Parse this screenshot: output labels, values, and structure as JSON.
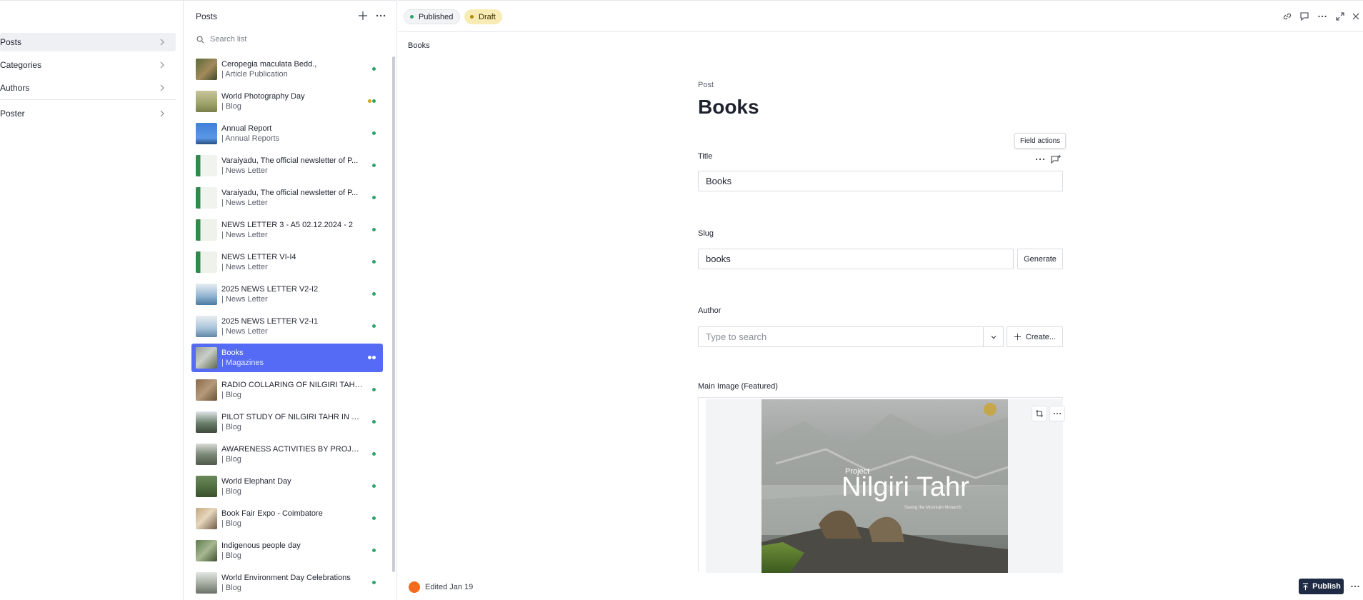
{
  "nav": {
    "items": [
      {
        "label": "Posts"
      },
      {
        "label": "Categories"
      },
      {
        "label": "Authors"
      },
      {
        "label": "Poster"
      }
    ]
  },
  "list": {
    "title": "Posts",
    "search_placeholder": "Search list",
    "rows": [
      {
        "title": "Ceropegia maculata Bedd.,",
        "sub": "| Article Publication"
      },
      {
        "title": "World Photography Day",
        "sub": "| Blog"
      },
      {
        "title": "Annual Report",
        "sub": "| Annual Reports"
      },
      {
        "title": "Varaiyadu, The official newsletter of P...",
        "sub": "| News Letter"
      },
      {
        "title": "Varaiyadu, The official newsletter of P...",
        "sub": "| News Letter"
      },
      {
        "title": "NEWS LETTER 3 - A5 02.12.2024 - 2",
        "sub": "| News Letter"
      },
      {
        "title": "NEWS LETTER VI-I4",
        "sub": "| News Letter"
      },
      {
        "title": "2025 NEWS LETTER V2-I2",
        "sub": "| News Letter"
      },
      {
        "title": "2025 NEWS LETTER V2-I1",
        "sub": "| News Letter"
      },
      {
        "title": "Books",
        "sub": "| Magazines"
      },
      {
        "title": "RADIO COLLARING OF NILGIRI TAHR ...",
        "sub": "| Blog"
      },
      {
        "title": "PILOT STUDY OF NILGIRI TAHR IN GR...",
        "sub": "| Blog"
      },
      {
        "title": "AWARENESS ACTIVITIES BY PROJECT ...",
        "sub": "| Blog"
      },
      {
        "title": "World Elephant Day",
        "sub": "| Blog"
      },
      {
        "title": "Book Fair Expo - Coimbatore",
        "sub": "| Blog"
      },
      {
        "title": "Indigenous people day",
        "sub": "| Blog"
      },
      {
        "title": "World Environment Day Celebrations",
        "sub": "| Blog"
      }
    ]
  },
  "header": {
    "published_label": "Published",
    "draft_label": "Draft"
  },
  "breadcrumb": "Books",
  "document": {
    "type_label": "Post",
    "title": "Books",
    "field_actions_tooltip": "Field actions"
  },
  "fields": {
    "title": {
      "label": "Title",
      "value": "Books"
    },
    "slug": {
      "label": "Slug",
      "value": "books",
      "generate_label": "Generate"
    },
    "author": {
      "label": "Author",
      "placeholder": "Type to search",
      "create_label": "Create..."
    },
    "main_image": {
      "label": "Main Image (Featured)",
      "overlay_kicker": "Project",
      "overlay_title": "Nilgiri Tahr",
      "overlay_tagline": "Saving the Mountain Monarch"
    }
  },
  "footer": {
    "edited_label": "Edited Jan 19",
    "publish_label": "Publish"
  },
  "colors": {
    "accent": "#556bf5",
    "published_dot": "#2ea56a",
    "draft_bg": "#f8ecb4",
    "publish_button": "#1f2a44",
    "avatar": "#f36b1c"
  }
}
